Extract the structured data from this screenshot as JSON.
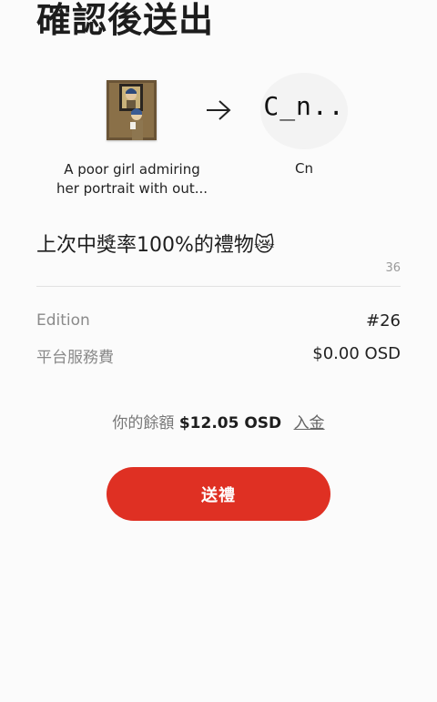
{
  "header": {
    "title": "確認後送出"
  },
  "gift": {
    "item_name": "A poor girl admiring\nher portrait with out...",
    "artwork_icon": "painting-thumbnail",
    "arrow_icon": "arrow-right-icon",
    "recipient_avatar_text": "C_n..",
    "recipient_name": "Cn"
  },
  "message": {
    "text": "上次中獎率100%的禮物😿",
    "char_count": "36"
  },
  "details": {
    "edition_label": "Edition",
    "edition_value": "#26",
    "fee_label": "平台服務費",
    "fee_value": "$0.00 OSD"
  },
  "balance": {
    "label": "你的餘額",
    "amount": "$12.05 OSD",
    "topup_label": "入金"
  },
  "actions": {
    "send_label": "送禮"
  },
  "colors": {
    "accent": "#df3023",
    "background": "#fbfbfb"
  }
}
